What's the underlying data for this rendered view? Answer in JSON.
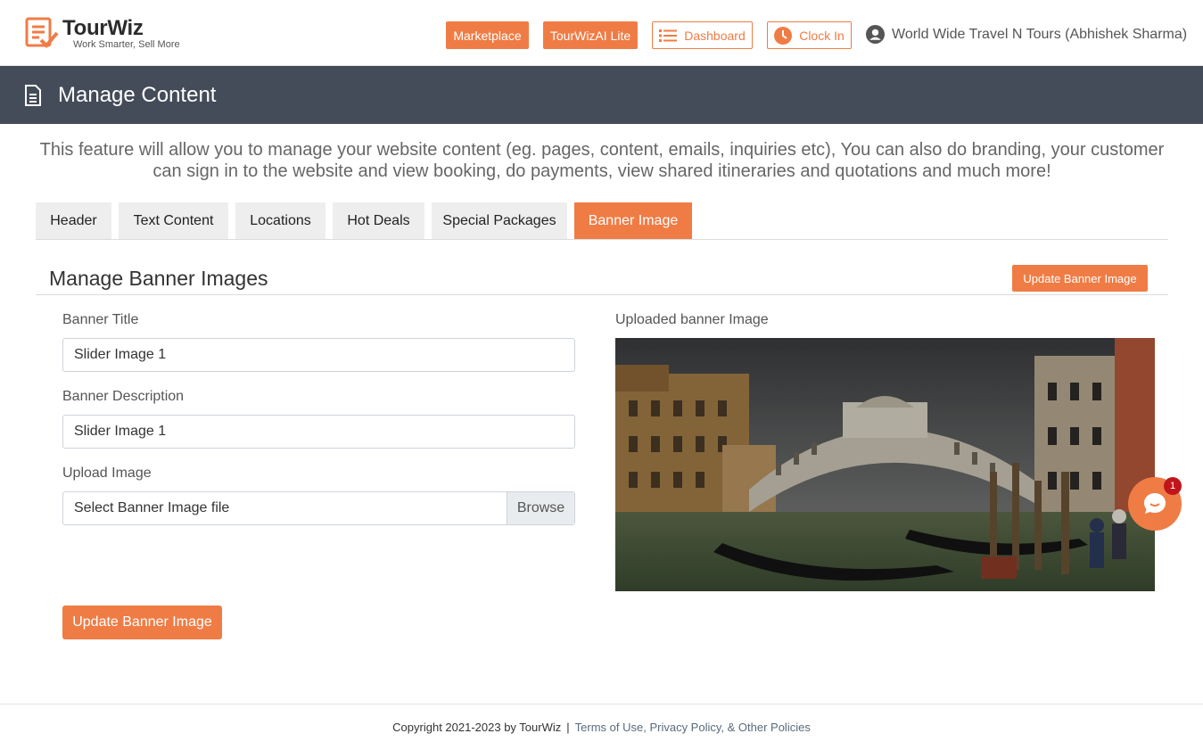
{
  "brand": {
    "name": "TourWiz",
    "tagline": "Work Smarter, Sell More",
    "accent_color": "#f07c45",
    "header_band_color": "#444c59"
  },
  "topnav": {
    "marketplace_label": "Marketplace",
    "tourwizai_label": "TourWizAI Lite",
    "dashboard_label": "Dashboard",
    "clockin_label": "Clock In",
    "user_label": "World Wide Travel N Tours (Abhishek Sharma)"
  },
  "page": {
    "title": "Manage Content",
    "intro": "This feature will allow you to manage your website content (eg. pages, content, emails, inquiries etc), You can also do branding, your customer can sign in to the website and view booking, do payments, view shared itineraries and quotations and much more!"
  },
  "tabs": [
    {
      "label": "Header"
    },
    {
      "label": "Text Content"
    },
    {
      "label": "Locations"
    },
    {
      "label": "Hot Deals"
    },
    {
      "label": "Special Packages"
    },
    {
      "label": "Banner Image"
    }
  ],
  "active_tab": "Banner Image",
  "banner_section": {
    "title": "Manage Banner Images",
    "top_update_label": "Update Banner Image",
    "banner_title_label": "Banner Title",
    "banner_title_value": "Slider Image 1",
    "banner_desc_label": "Banner Description",
    "banner_desc_value": "Slider Image 1",
    "upload_label": "Upload Image",
    "upload_placeholder": "Select Banner Image file",
    "browse_label": "Browse",
    "uploaded_label": "Uploaded banner Image",
    "update_label": "Update Banner Image"
  },
  "chat": {
    "badge_count": "1"
  },
  "footer": {
    "copyright": "Copyright 2021-2023 by TourWiz",
    "separator": "|",
    "policies": "Terms of Use, Privacy Policy, & Other Policies"
  }
}
